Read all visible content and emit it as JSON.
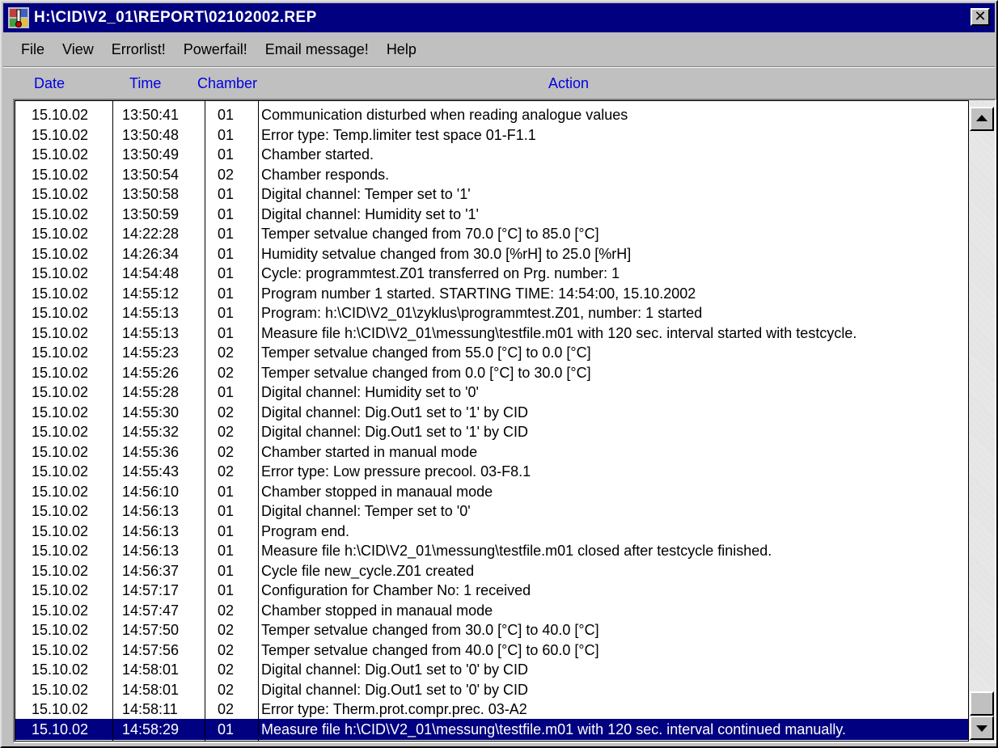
{
  "window": {
    "title": "H:\\CID\\V2_01\\REPORT\\02102002.REP",
    "close_glyph": "✕",
    "icon": "thermometer-app-icon"
  },
  "menu": [
    "File",
    "View",
    "Errorlist!",
    "Powerfail!",
    "Email message!",
    "Help"
  ],
  "columns": {
    "date": "Date",
    "time": "Time",
    "chamber": "Chamber",
    "action": "Action"
  },
  "colors": {
    "title_bg": "#000080",
    "header_text": "#0000e0",
    "selected_bg": "#000080"
  },
  "rows": [
    {
      "date": "15.10.02",
      "time": "13:50:41",
      "chamber": "01",
      "action": "Communication disturbed when reading analogue values"
    },
    {
      "date": "15.10.02",
      "time": "13:50:48",
      "chamber": "01",
      "action": "Error type: Temp.limiter test space 01-F1.1"
    },
    {
      "date": "15.10.02",
      "time": "13:50:49",
      "chamber": "01",
      "action": "Chamber started."
    },
    {
      "date": "15.10.02",
      "time": "13:50:54",
      "chamber": "02",
      "action": "Chamber responds."
    },
    {
      "date": "15.10.02",
      "time": "13:50:58",
      "chamber": "01",
      "action": "Digital channel: Temper    set to '1'"
    },
    {
      "date": "15.10.02",
      "time": "13:50:59",
      "chamber": "01",
      "action": "Digital channel: Humidity  set to '1'"
    },
    {
      "date": "15.10.02",
      "time": "14:22:28",
      "chamber": "01",
      "action": "Temper setvalue changed from 70.0  [°C] to 85.0  [°C]"
    },
    {
      "date": "15.10.02",
      "time": "14:26:34",
      "chamber": "01",
      "action": "Humidity setvalue changed from 30.0 [%rH] to 25.0 [%rH]"
    },
    {
      "date": "15.10.02",
      "time": "14:54:48",
      "chamber": "01",
      "action": "Cycle: programmtest.Z01 transferred on Prg. number: 1"
    },
    {
      "date": "15.10.02",
      "time": "14:55:12",
      "chamber": "01",
      "action": "Program number 1 started. STARTING TIME: 14:54:00, 15.10.2002"
    },
    {
      "date": "15.10.02",
      "time": "14:55:13",
      "chamber": "01",
      "action": "Program: h:\\CID\\V2_01\\zyklus\\programmtest.Z01, number: 1 started"
    },
    {
      "date": "15.10.02",
      "time": "14:55:13",
      "chamber": "01",
      "action": "Measure file h:\\CID\\V2_01\\messung\\testfile.m01 with 120 sec. interval started with testcycle."
    },
    {
      "date": "15.10.02",
      "time": "14:55:23",
      "chamber": "02",
      "action": "Temper setvalue changed from 55.0  [°C] to 0.0  [°C]"
    },
    {
      "date": "15.10.02",
      "time": "14:55:26",
      "chamber": "02",
      "action": "Temper setvalue changed from 0.0  [°C] to 30.0  [°C]"
    },
    {
      "date": "15.10.02",
      "time": "14:55:28",
      "chamber": "01",
      "action": "Digital channel: Humidity  set to '0'"
    },
    {
      "date": "15.10.02",
      "time": "14:55:30",
      "chamber": "02",
      "action": "Digital channel: Dig.Out1  set to '1' by CID"
    },
    {
      "date": "15.10.02",
      "time": "14:55:32",
      "chamber": "02",
      "action": "Digital channel: Dig.Out1  set to '1' by CID"
    },
    {
      "date": "15.10.02",
      "time": "14:55:36",
      "chamber": "02",
      "action": "Chamber started in manual mode"
    },
    {
      "date": "15.10.02",
      "time": "14:55:43",
      "chamber": "02",
      "action": "Error type: Low pressure precool.  03-F8.1"
    },
    {
      "date": "15.10.02",
      "time": "14:56:10",
      "chamber": "01",
      "action": "Chamber stopped in manaual mode"
    },
    {
      "date": "15.10.02",
      "time": "14:56:13",
      "chamber": "01",
      "action": "Digital channel: Temper    set to '0'"
    },
    {
      "date": "15.10.02",
      "time": "14:56:13",
      "chamber": "01",
      "action": "Program end."
    },
    {
      "date": "15.10.02",
      "time": "14:56:13",
      "chamber": "01",
      "action": "Measure file h:\\CID\\V2_01\\messung\\testfile.m01 closed after testcycle finished."
    },
    {
      "date": "15.10.02",
      "time": "14:56:37",
      "chamber": "01",
      "action": "Cycle file new_cycle.Z01 created"
    },
    {
      "date": "15.10.02",
      "time": "14:57:17",
      "chamber": "01",
      "action": "Configuration for Chamber No:  1 received"
    },
    {
      "date": "15.10.02",
      "time": "14:57:47",
      "chamber": "02",
      "action": "Chamber stopped in manaual mode"
    },
    {
      "date": "15.10.02",
      "time": "14:57:50",
      "chamber": "02",
      "action": "Temper setvalue changed from 30.0  [°C] to 40.0  [°C]"
    },
    {
      "date": "15.10.02",
      "time": "14:57:56",
      "chamber": "02",
      "action": "Temper setvalue changed from 40.0  [°C] to 60.0  [°C]"
    },
    {
      "date": "15.10.02",
      "time": "14:58:01",
      "chamber": "02",
      "action": "Digital channel: Dig.Out1  set to '0' by CID"
    },
    {
      "date": "15.10.02",
      "time": "14:58:01",
      "chamber": "02",
      "action": "Digital channel: Dig.Out1  set to '0' by CID"
    },
    {
      "date": "15.10.02",
      "time": "14:58:11",
      "chamber": "02",
      "action": "Error type: Therm.prot.compr.prec. 03-A2"
    },
    {
      "date": "15.10.02",
      "time": "14:58:29",
      "chamber": "01",
      "action": "Measure file h:\\CID\\V2_01\\messung\\testfile.m01 with 120 sec. interval continued manually.",
      "selected": true
    }
  ]
}
